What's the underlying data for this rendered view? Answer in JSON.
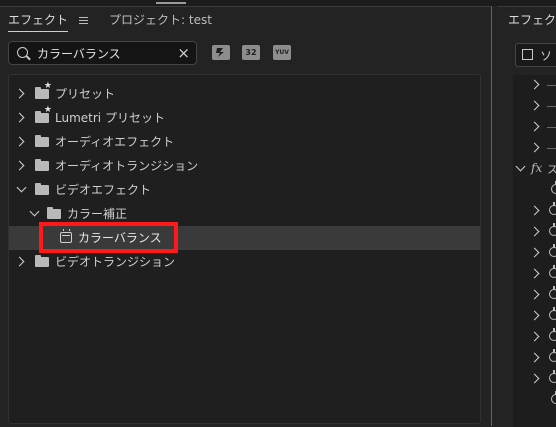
{
  "effects_panel": {
    "tabs": [
      {
        "label": "エフェクト"
      },
      {
        "label": "プロジェクト: test"
      }
    ],
    "search": {
      "value": "カラーバランス",
      "clear_glyph": "×"
    },
    "filter_buttons": [
      {
        "label": "",
        "icon": "accelerated-effects-icon"
      },
      {
        "label": "32",
        "icon": "32bit-effects-icon"
      },
      {
        "label": "YUV",
        "icon": "yuv-effects-icon"
      }
    ],
    "tree": [
      {
        "label": "プリセット",
        "expanded": false,
        "icon": "preset-folder-icon"
      },
      {
        "label": "Lumetri プリセット",
        "expanded": false,
        "icon": "preset-folder-icon"
      },
      {
        "label": "オーディオエフェクト",
        "expanded": false,
        "icon": "folder-icon"
      },
      {
        "label": "オーディオトランジション",
        "expanded": false,
        "icon": "folder-icon"
      },
      {
        "label": "ビデオエフェクト",
        "expanded": true,
        "icon": "folder-icon"
      },
      {
        "label": "カラー補正",
        "expanded": true,
        "icon": "folder-icon"
      },
      {
        "label": "カラーバランス",
        "selected": true,
        "icon": "effect-icon"
      },
      {
        "label": "ビデオトランジション",
        "expanded": false,
        "icon": "folder-icon"
      }
    ],
    "highlight_color": "#ff1a1a"
  },
  "controls_panel": {
    "tab_label": "エフェクト",
    "source_label": "ソ",
    "fx_label": "fx",
    "fx_suffix": "ス"
  }
}
